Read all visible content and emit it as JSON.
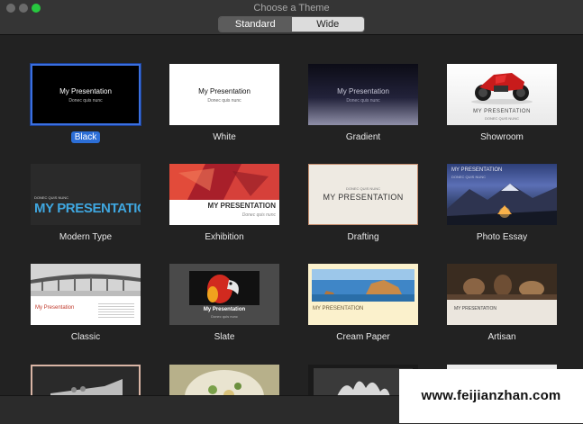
{
  "window": {
    "title": "Choose a Theme"
  },
  "segmented": {
    "standard": "Standard",
    "wide": "Wide",
    "selected": "Standard"
  },
  "themes": [
    {
      "name": "Black",
      "thumb_title": "My Presentation",
      "thumb_sub": "Donec quis nunc",
      "selected": true
    },
    {
      "name": "White",
      "thumb_title": "My Presentation",
      "thumb_sub": "Donec quis nunc"
    },
    {
      "name": "Gradient",
      "thumb_title": "My Presentation",
      "thumb_sub": "Donec quis nunc"
    },
    {
      "name": "Showroom",
      "thumb_title": "MY PRESENTATION",
      "thumb_sub": "DONEC QUIS NUNC"
    },
    {
      "name": "Modern Type",
      "thumb_title": "MY PRESENTATION",
      "thumb_sub": "DONEC QUIS NUNC"
    },
    {
      "name": "Exhibition",
      "thumb_title": "MY PRESENTATION",
      "thumb_sub": "Donec quis nunc"
    },
    {
      "name": "Drafting",
      "thumb_title": "MY PRESENTATION",
      "thumb_sub": "DONEC QUIS NUNC"
    },
    {
      "name": "Photo Essay",
      "thumb_title": "MY PRESENTATION",
      "thumb_sub": "DONEC QUIS NUNC"
    },
    {
      "name": "Classic",
      "thumb_title": "My Presentation",
      "thumb_sub": ""
    },
    {
      "name": "Slate",
      "thumb_title": "My Presentation",
      "thumb_sub": "Donec quis nunc"
    },
    {
      "name": "Cream Paper",
      "thumb_title": "MY PRESENTATION",
      "thumb_sub": ""
    },
    {
      "name": "Artisan",
      "thumb_title": "MY PRESENTATION",
      "thumb_sub": ""
    }
  ],
  "watermark": {
    "text": "www.feijianzhan.com"
  },
  "colors": {
    "accent": "#2c6ed6",
    "selection_border": "#3a6fe0"
  }
}
